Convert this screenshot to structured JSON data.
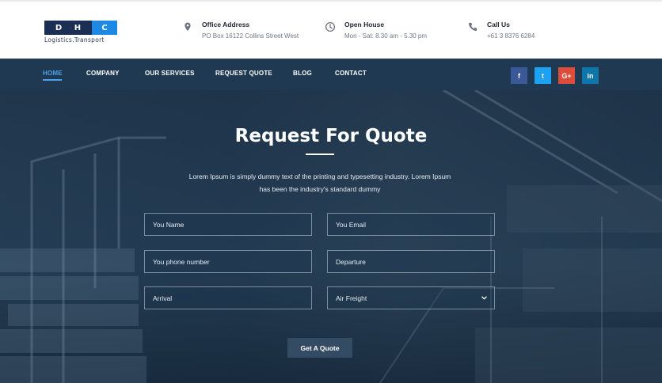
{
  "header": {
    "logo": {
      "letters": [
        "D",
        "H",
        "C"
      ],
      "tagline": "Logistics.Transport"
    },
    "address": {
      "icon": "map-pin-icon",
      "title": "Office Address",
      "text": "PO Box 16122 Collins Street West"
    },
    "hours": {
      "icon": "clock-icon",
      "title": "Open House",
      "text": "Mon - Sat: 8.30 am - 5.30 pm"
    },
    "call": {
      "icon": "phone-icon",
      "title": "Call Us",
      "text": "+61 3 8376 6284"
    }
  },
  "nav": {
    "items": [
      {
        "label": "HOME",
        "active": true
      },
      {
        "label": "COMPANY"
      },
      {
        "label": "OUR SERVICES"
      },
      {
        "label": "REQUEST QUOTE"
      },
      {
        "label": "BLOG"
      },
      {
        "label": "CONTACT"
      }
    ],
    "social": [
      {
        "icon": "facebook-icon",
        "glyph": "f"
      },
      {
        "icon": "twitter-icon",
        "glyph": "t"
      },
      {
        "icon": "google-plus-icon",
        "glyph": "G+"
      },
      {
        "icon": "linkedin-icon",
        "glyph": "in"
      }
    ]
  },
  "hero": {
    "title": "Request For Quote",
    "description": "Lorem Ipsum is simply dummy text of the printing and typesetting industry. Lorem Ipsum has been the industry's standard dummy"
  },
  "form": {
    "name_placeholder": "You Name",
    "email_placeholder": "You Email",
    "phone_placeholder": "You phone number",
    "departure_placeholder": "Departure",
    "arrival_placeholder": "Arrival",
    "freight_selected": "Air Freight",
    "submit_label": "Get A Quote"
  },
  "colors": {
    "accent": "#4ea1ea",
    "nav_bg": "#1e3951",
    "logo_dark": "#1b2f55",
    "logo_blue": "#1e88e5"
  }
}
